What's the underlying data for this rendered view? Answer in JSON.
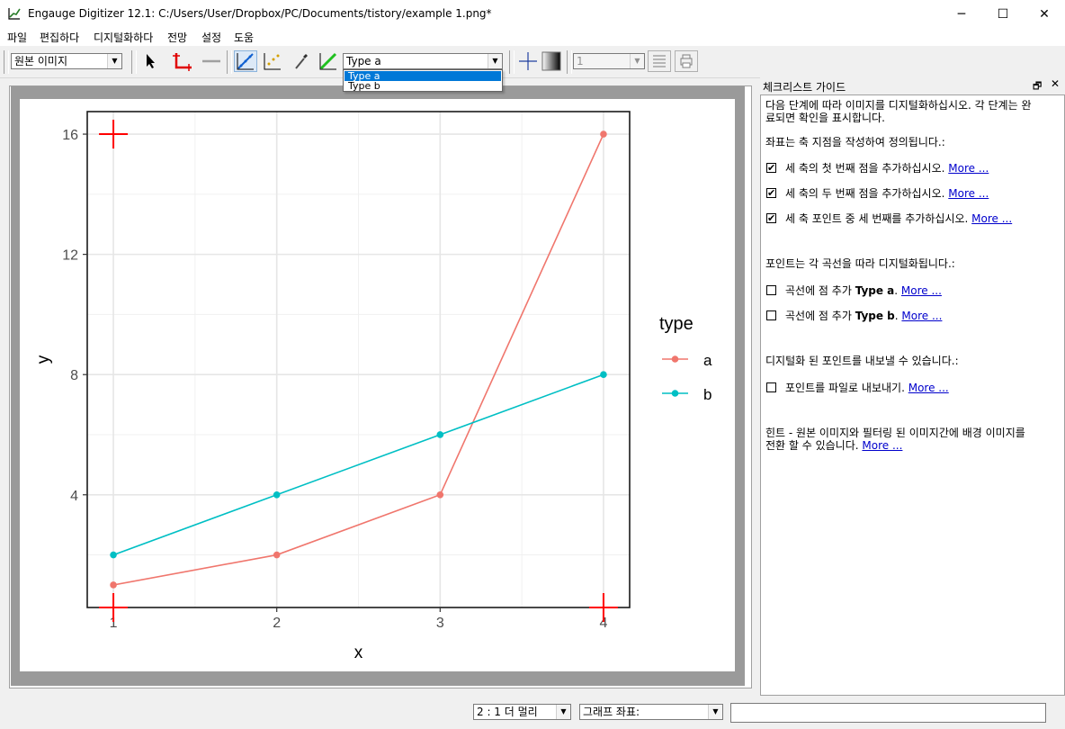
{
  "window": {
    "title": "Engauge Digitizer 12.1: C:/Users/User/Dropbox/PC/Documents/tistory/example 1.png*",
    "minimize_glyph": "─",
    "maximize_glyph": "☐",
    "close_glyph": "✕"
  },
  "menu": [
    "파일",
    "편집하다",
    "디지털화하다",
    "전망",
    "설정",
    "도움"
  ],
  "toolbar": {
    "background_combo": "원본 이미지",
    "curve_combo": "Type a",
    "point_combo": "1",
    "icons": [
      "select-arrow-icon",
      "axis-point-icon",
      "line-icon",
      "curve-point-icon",
      "point-match-icon",
      "color-picker-icon",
      "segment-fill-icon",
      "crosshair-icon",
      "gradient-icon",
      "list-icon",
      "print-icon"
    ]
  },
  "dropdown": {
    "options": [
      "Type a",
      "Type b"
    ],
    "selected": "Type a"
  },
  "chart_data": {
    "type": "line",
    "xlabel": "x",
    "ylabel": "y",
    "x": [
      1,
      2,
      3,
      4
    ],
    "x_ticks": [
      "1",
      "2",
      "3",
      "4"
    ],
    "y_ticks": [
      "4",
      "8",
      "12",
      "16"
    ],
    "xlim": [
      0.84,
      4.16
    ],
    "ylim": [
      0.25,
      16.75
    ],
    "legend_title": "type",
    "legend_position": "right",
    "grid": true,
    "series": [
      {
        "name": "a",
        "color": "#f0766d",
        "values": [
          1,
          2,
          4,
          16
        ]
      },
      {
        "name": "b",
        "color": "#00bfc4",
        "values": [
          2,
          4,
          6,
          8
        ]
      }
    ],
    "axis_markers": [
      {
        "x": 1,
        "y": 16
      },
      {
        "x": 1,
        "y": 0.25
      },
      {
        "x": 4,
        "y": 0.25
      }
    ]
  },
  "checklist": {
    "title": "체크리스트 가이드",
    "intro_line1": "다음 단계에 따라 이미지를 디지털화하십시오. 각 단계는 완",
    "intro_line2": "료되면 확인을 표시합니다.",
    "axes_header": "좌표는 축 지점을 작성하여 정의됩니다.:",
    "axes_items": [
      {
        "text": "세 축의 첫 번째 점을 추가하십시오.",
        "checked": true
      },
      {
        "text": "세 축의 두 번째 점을 추가하십시오.",
        "checked": true
      },
      {
        "text": "세 축 포인트 중 세 번째를 추가하십시오.",
        "checked": true
      }
    ],
    "curves_header": "포인트는 각 곡선을 따라 디지털화됩니다.:",
    "curve_prefix": "곡선에 점 추가 ",
    "curve_items": [
      {
        "name": "Type a",
        "checked": false
      },
      {
        "name": "Type b",
        "checked": false
      }
    ],
    "export_header": "디지털화 된 포인트를 내보낼 수 있습니다.:",
    "export_item": {
      "text": "포인트를 파일로 내보내기.",
      "checked": false
    },
    "hint_line1": "힌트 - 원본 이미지와 필터링 된 이미지간에 배경 이미지를",
    "hint_line2": "전환 할 수 있습니다.",
    "more_label": "More ...",
    "check_glyph": "✔"
  },
  "statusbar": {
    "zoom": "2 : 1 더 멀리",
    "coords_combo": "그래프 좌표:",
    "coords_value": ""
  }
}
